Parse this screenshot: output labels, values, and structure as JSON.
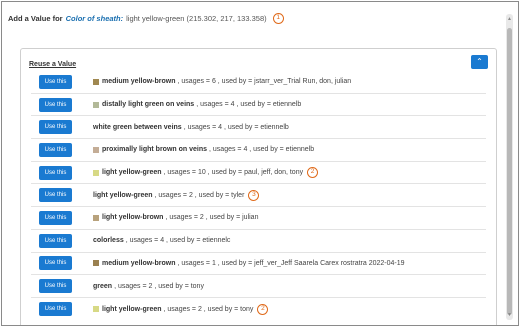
{
  "header": {
    "prefix": "Add a Value for",
    "character": "Color of sheath:",
    "value_text": "light yellow-green (215.302, 217, 133.358)",
    "marker": "1"
  },
  "panel": {
    "title": "Reuse a Value",
    "collapse_icon": "chevron-up-icon"
  },
  "rows": [
    {
      "button": "Use this",
      "swatch": "#a08850",
      "name": "medium yellow-brown",
      "rest": ", usages = 6 , used by = jstarr_ver_Trial Run, don, julian",
      "marker": ""
    },
    {
      "button": "Use this",
      "swatch": "#b2b998",
      "name": "distally light green on veins",
      "rest": ", usages = 4 , used by = etiennelb",
      "marker": ""
    },
    {
      "button": "Use this",
      "swatch": "",
      "name": "white green between veins",
      "rest": ", usages = 4 , used by = etiennelb",
      "marker": ""
    },
    {
      "button": "Use this",
      "swatch": "#c4ad96",
      "name": "proximally light brown on veins",
      "rest": ", usages = 4 , used by = etiennelb",
      "marker": ""
    },
    {
      "button": "Use this",
      "swatch": "#d7d985",
      "name": "light yellow-green",
      "rest": ", usages = 10 , used by = paul, jeff, don, tony",
      "marker": "2"
    },
    {
      "button": "Use this",
      "swatch": "",
      "name": "light yellow-green",
      "rest": ", usages = 2 , used by = tyler",
      "marker": "3"
    },
    {
      "button": "Use this",
      "swatch": "#b8a27c",
      "name": "light yellow-brown",
      "rest": ", usages = 2 , used by = julian",
      "marker": ""
    },
    {
      "button": "Use this",
      "swatch": "",
      "name": "colorless",
      "rest": ", usages = 4 , used by = etiennelc",
      "marker": ""
    },
    {
      "button": "Use this",
      "swatch": "#9a8050",
      "name": "medium yellow-brown",
      "rest": ", usages = 1 , used by = jeff_ver_Jeff Saarela Carex rostratra 2022-04-19",
      "marker": ""
    },
    {
      "button": "Use this",
      "swatch": "",
      "name": "green",
      "rest": ", usages = 2 , used by = tony",
      "marker": ""
    },
    {
      "button": "Use this",
      "swatch": "#d7d985",
      "name": "light yellow-green",
      "rest": ", usages = 2 , used by = tony",
      "marker": "2"
    }
  ],
  "colors": {
    "accent": "#1a7ad1",
    "marker": "#e06a1a",
    "character_link": "#1a6fb0"
  }
}
